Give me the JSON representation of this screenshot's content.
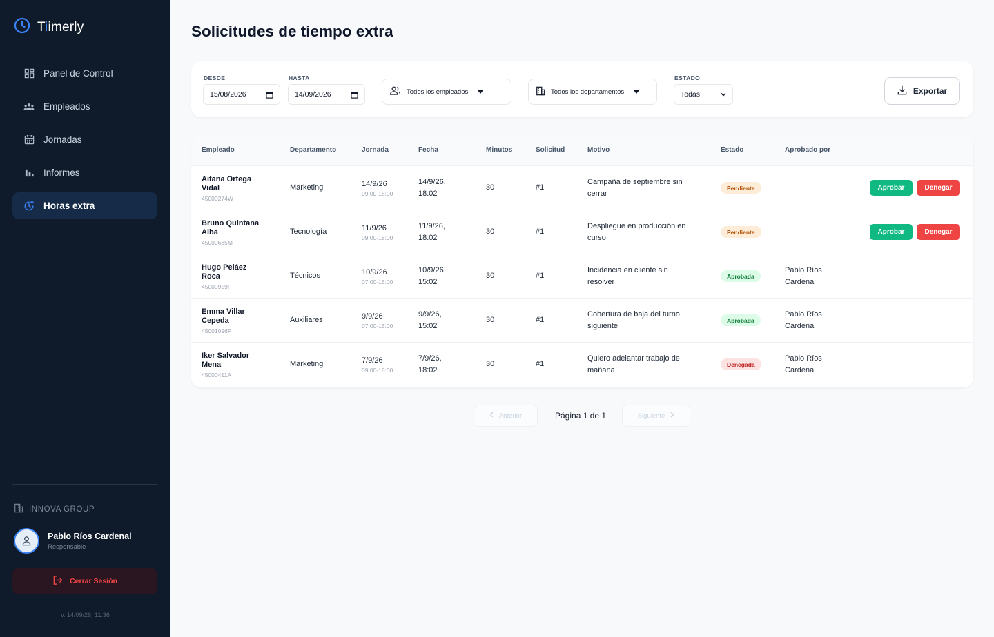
{
  "app": {
    "brand_prefix": "T",
    "brand_highlight": "i",
    "brand_suffix": "imerly"
  },
  "sidebar": {
    "items": [
      {
        "label": "Panel de Control",
        "icon": "dashboard-icon"
      },
      {
        "label": "Empleados",
        "icon": "users-icon"
      },
      {
        "label": "Jornadas",
        "icon": "calendar-icon"
      },
      {
        "label": "Informes",
        "icon": "bar-chart-icon"
      },
      {
        "label": "Horas extra",
        "icon": "clock-plus-icon",
        "active": true
      }
    ],
    "org": "INNOVA GROUP",
    "user_name": "Pablo Ríos Cardenal",
    "user_role": "Responsable",
    "logout": "Cerrar Sesión",
    "version": "v. 14/09/26, 11:36"
  },
  "page": {
    "title": "Solicitudes de tiempo extra"
  },
  "filters": {
    "desde_label": "DESDE",
    "desde_value": "15/08/2026",
    "hasta_label": "HASTA",
    "hasta_value": "14/09/2026",
    "employees": "Todos los empleados",
    "departments": "Todos los departamentos",
    "estado_label": "ESTADO",
    "estado_value": "Todas",
    "export": "Exportar"
  },
  "table": {
    "headers": [
      "Empleado",
      "Departamento",
      "Jornada",
      "Fecha",
      "Minutos",
      "Solicitud",
      "Motivo",
      "Estado",
      "Aprobado por"
    ],
    "approve_label": "Aprobar",
    "deny_label": "Denegar",
    "rows": [
      {
        "name1": "Aitana Ortega",
        "name2": "Vidal",
        "id": "45000274W",
        "dept": "Marketing",
        "jornada": "14/9/26",
        "horario": "09:00-18:00",
        "fecha1": "14/9/26,",
        "fecha2": "18:02",
        "minutos": "30",
        "solicitud": "#1",
        "motivo1": "Campaña de septiembre sin",
        "motivo2": "cerrar",
        "estado": "Pendiente",
        "aprob1": "",
        "aprob2": ""
      },
      {
        "name1": "Bruno Quintana",
        "name2": "Alba",
        "id": "45000685M",
        "dept": "Tecnología",
        "jornada": "11/9/26",
        "horario": "09:00-18:00",
        "fecha1": "11/9/26,",
        "fecha2": "18:02",
        "minutos": "30",
        "solicitud": "#1",
        "motivo1": "Despliegue en producción en",
        "motivo2": "curso",
        "estado": "Pendiente",
        "aprob1": "",
        "aprob2": ""
      },
      {
        "name1": "Hugo Peláez",
        "name2": "Roca",
        "id": "45000959F",
        "dept": "Técnicos",
        "jornada": "10/9/26",
        "horario": "07:00-15:00",
        "fecha1": "10/9/26,",
        "fecha2": "15:02",
        "minutos": "30",
        "solicitud": "#1",
        "motivo1": "Incidencia en cliente sin",
        "motivo2": "resolver",
        "estado": "Aprobada",
        "aprob1": "Pablo Ríos",
        "aprob2": "Cardenal"
      },
      {
        "name1": "Emma Villar",
        "name2": "Cepeda",
        "id": "45001096P",
        "dept": "Auxiliares",
        "jornada": "9/9/26",
        "horario": "07:00-15:00",
        "fecha1": "9/9/26,",
        "fecha2": "15:02",
        "minutos": "30",
        "solicitud": "#1",
        "motivo1": "Cobertura de baja del turno",
        "motivo2": "siguiente",
        "estado": "Aprobada",
        "aprob1": "Pablo Ríos",
        "aprob2": "Cardenal"
      },
      {
        "name1": "Iker Salvador",
        "name2": "Mena",
        "id": "45000411A",
        "dept": "Marketing",
        "jornada": "7/9/26",
        "horario": "09:00-18:00",
        "fecha1": "7/9/26,",
        "fecha2": "18:02",
        "minutos": "30",
        "solicitud": "#1",
        "motivo1": "Quiero adelantar trabajo de",
        "motivo2": "mañana",
        "estado": "Denegada",
        "aprob1": "Pablo Ríos",
        "aprob2": "Cardenal"
      }
    ]
  },
  "pagination": {
    "prev": "Anterior",
    "page_text": "Página 1 de 1",
    "next": "Siguiente"
  },
  "colors": {
    "sidebar_bg": "#0f1a2b",
    "accent": "#3b82f6",
    "approve": "#10b981",
    "deny": "#ef4444"
  }
}
